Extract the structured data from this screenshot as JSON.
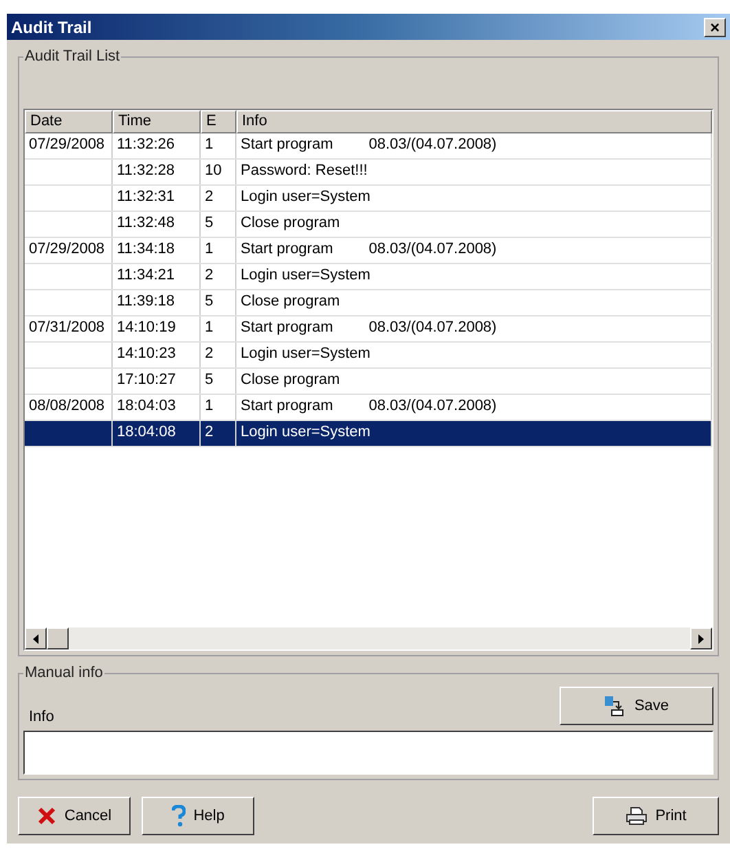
{
  "window": {
    "title": "Audit Trail",
    "close": "×"
  },
  "list_group": {
    "title": "Audit Trail List"
  },
  "table": {
    "columns": [
      "Date",
      "Time",
      "E",
      "Info"
    ],
    "rows": [
      {
        "date": "07/29/2008",
        "time": "11:32:26",
        "e": "1",
        "info": "Start program",
        "detail": "08.03/(04.07.2008)",
        "selected": false
      },
      {
        "time": "11:32:28",
        "e": "10",
        "info": "Password: Reset!!!",
        "selected": false
      },
      {
        "time": "11:32:31",
        "e": "2",
        "info": "Login user=System",
        "selected": false
      },
      {
        "time": "11:32:48",
        "e": "5",
        "info": "Close program",
        "selected": false
      },
      {
        "date": "07/29/2008",
        "time": "11:34:18",
        "e": "1",
        "info": "Start program",
        "detail": "08.03/(04.07.2008)",
        "selected": false
      },
      {
        "time": "11:34:21",
        "e": "2",
        "info": "Login user=System",
        "selected": false
      },
      {
        "time": "11:39:18",
        "e": "5",
        "info": "Close program",
        "selected": false
      },
      {
        "date": "07/31/2008",
        "time": "14:10:19",
        "e": "1",
        "info": "Start program",
        "detail": "08.03/(04.07.2008)",
        "selected": false
      },
      {
        "time": "14:10:23",
        "e": "2",
        "info": "Login user=System",
        "selected": false
      },
      {
        "time": "17:10:27",
        "e": "5",
        "info": "Close program",
        "selected": false
      },
      {
        "date": "08/08/2008",
        "time": "18:04:03",
        "e": "1",
        "info": "Start program",
        "detail": "08.03/(04.07.2008)",
        "selected": false
      },
      {
        "time": "18:04:08",
        "e": "2",
        "info": "Login user=System",
        "selected": true
      }
    ]
  },
  "manual_group": {
    "title": "Manual info",
    "field_label": "Info",
    "save_button": "Save"
  },
  "buttons": [
    {
      "kind": "cancel",
      "label": "Cancel"
    },
    {
      "kind": "help",
      "label": "Help"
    },
    {
      "kind": "print",
      "label": "Print"
    }
  ]
}
